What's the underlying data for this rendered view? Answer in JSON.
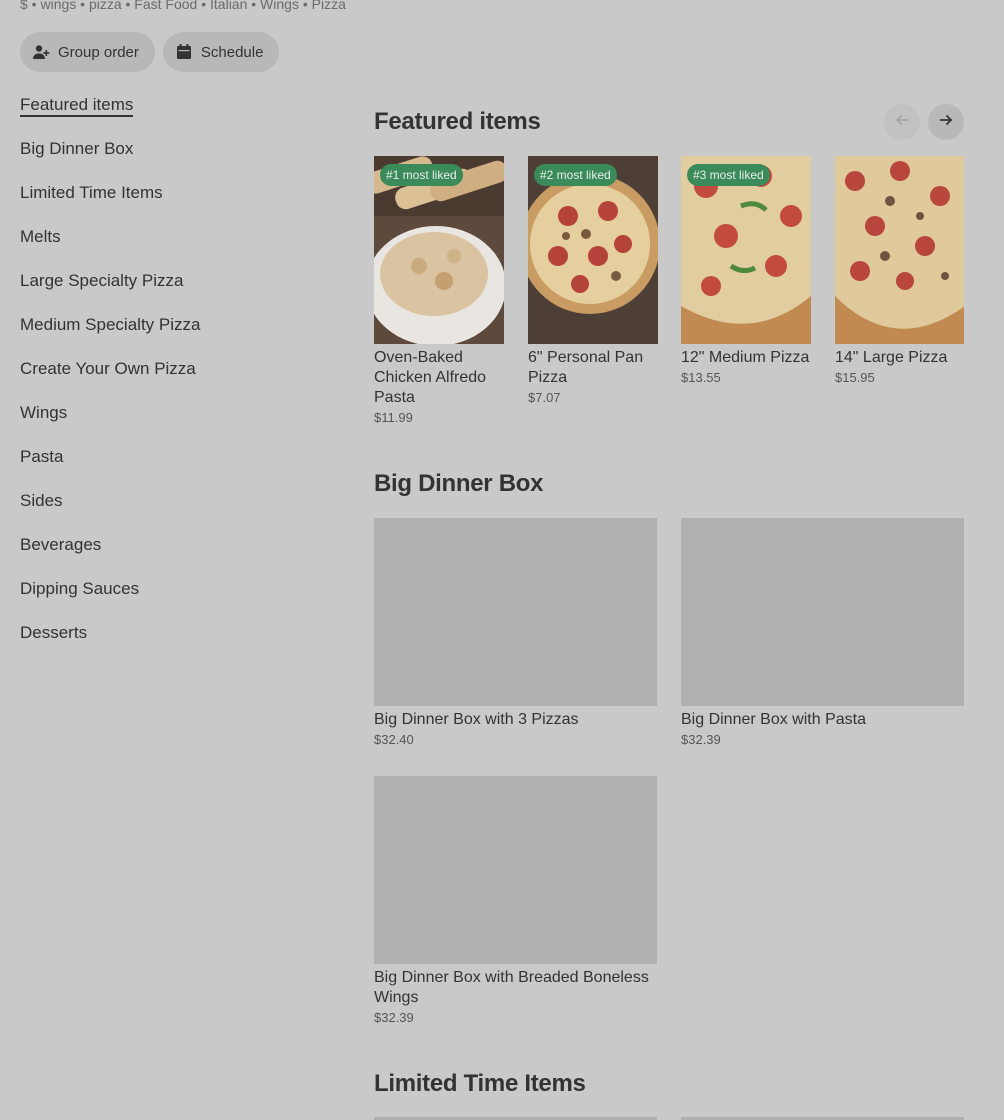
{
  "store": {
    "tagline": "$ • wings • pizza • Fast Food • Italian • Wings • Pizza"
  },
  "actions": {
    "group_order": "Group order",
    "schedule": "Schedule"
  },
  "sidebar": {
    "items": [
      {
        "label": "Featured items",
        "active": true
      },
      {
        "label": "Big Dinner Box"
      },
      {
        "label": "Limited Time Items"
      },
      {
        "label": "Melts"
      },
      {
        "label": "Large Specialty Pizza"
      },
      {
        "label": "Medium Specialty Pizza"
      },
      {
        "label": "Create Your Own Pizza"
      },
      {
        "label": "Wings"
      },
      {
        "label": "Pasta"
      },
      {
        "label": "Sides"
      },
      {
        "label": "Beverages"
      },
      {
        "label": "Dipping Sauces"
      },
      {
        "label": "Desserts"
      }
    ]
  },
  "featured": {
    "title": "Featured items",
    "items": [
      {
        "badge": "#1 most liked",
        "name": "Oven-Baked Chicken Alfredo Pasta",
        "price": "$11.99",
        "image": "pasta-breadsticks"
      },
      {
        "badge": "#2 most liked",
        "name": "6\" Personal Pan Pizza",
        "price": "$7.07",
        "image": "pepperoni-sausage-pizza"
      },
      {
        "badge": "#3 most liked",
        "name": "12\" Medium Pizza",
        "price": "$13.55",
        "image": "pepperoni-pepper-pizza"
      },
      {
        "badge": "",
        "name": "14\" Large Pizza",
        "price": "$15.95",
        "image": "supreme-pizza"
      }
    ]
  },
  "big_dinner_box": {
    "title": "Big Dinner Box",
    "items": [
      {
        "name": "Big Dinner Box with 3 Pizzas",
        "price": "$32.40"
      },
      {
        "name": "Big Dinner Box with Pasta",
        "price": "$32.39"
      },
      {
        "name": "Big Dinner Box with Breaded Boneless Wings",
        "price": "$32.39"
      }
    ]
  },
  "limited_time": {
    "title": "Limited Time Items"
  },
  "colors": {
    "background": "#c9c9c9",
    "badge": "#3a8a5a",
    "placeholder": "#b0b0b0"
  }
}
